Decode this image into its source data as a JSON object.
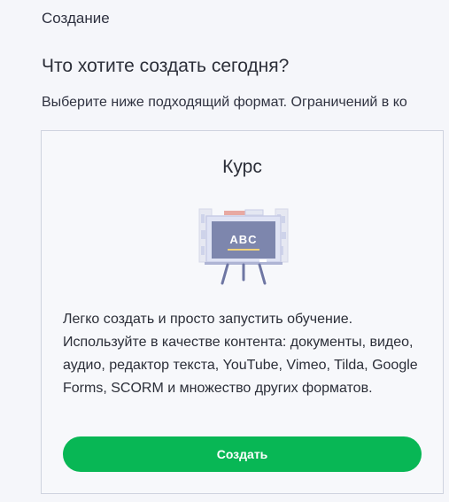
{
  "header": {
    "breadcrumb": "Создание",
    "title": "Что хотите создать сегодня?",
    "subtitle": "Выберите ниже подходящий формат. Ограничений в ко"
  },
  "card": {
    "title": "Курс",
    "illustration": {
      "icon": "classroom-board-icon",
      "board_text": "ABC"
    },
    "description": "Легко создать и просто запустить обучение. Используйте в качестве контента: документы, видео, аудио, редактор текста, YouTube, Vimeo, Tilda, Google Forms, SCORM и множество других форматов.",
    "button_label": "Создать"
  },
  "colors": {
    "accent": "#08b755",
    "board": "#7d86ad",
    "board_frame": "#c8cde6",
    "easel": "#6e76a3",
    "background": "#f5f6fa"
  }
}
